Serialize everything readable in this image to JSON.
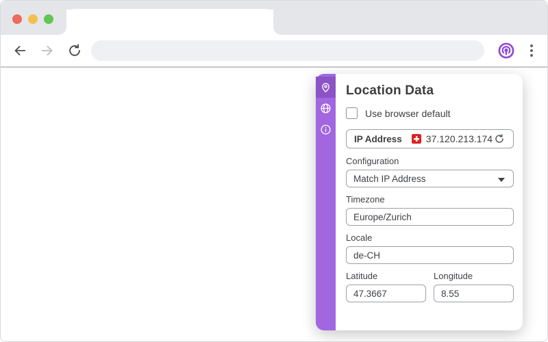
{
  "browser": {
    "tab_title": "",
    "address_bar": {
      "value": "",
      "placeholder": ""
    },
    "nav": {
      "back": "back-arrow",
      "forward": "forward-arrow",
      "reload": "reload-arrow"
    },
    "extension": "vytal-location-extension",
    "menu": "kebab-menu"
  },
  "colors": {
    "sidebar_purple": "#a266e0",
    "sidebar_active_purple": "#8b53c6",
    "extension_purple": "#8f4bd6",
    "flag_red": "#e02020",
    "titlebar_gray": "#e5e6e9",
    "addressbar_gray": "#eef0f3",
    "traffic_red": "#ed6a5e",
    "traffic_yellow": "#f5bf4f",
    "traffic_green": "#62c554"
  },
  "popup": {
    "title": "Location Data",
    "sidebar_icons": [
      "location-pin-icon",
      "globe-icon",
      "info-icon"
    ],
    "checkbox": {
      "label": "Use browser default",
      "checked": false
    },
    "ip": {
      "label": "IP Address",
      "value": "37.120.213.174",
      "flag": "swiss-flag",
      "refresh": "refresh-icon"
    },
    "fields": {
      "configuration": {
        "label": "Configuration",
        "value": "Match IP Address"
      },
      "timezone": {
        "label": "Timezone",
        "value": "Europe/Zurich"
      },
      "locale": {
        "label": "Locale",
        "value": "de-CH"
      },
      "latitude": {
        "label": "Latitude",
        "value": "47.3667"
      },
      "longitude": {
        "label": "Longitude",
        "value": "8.55"
      }
    }
  }
}
